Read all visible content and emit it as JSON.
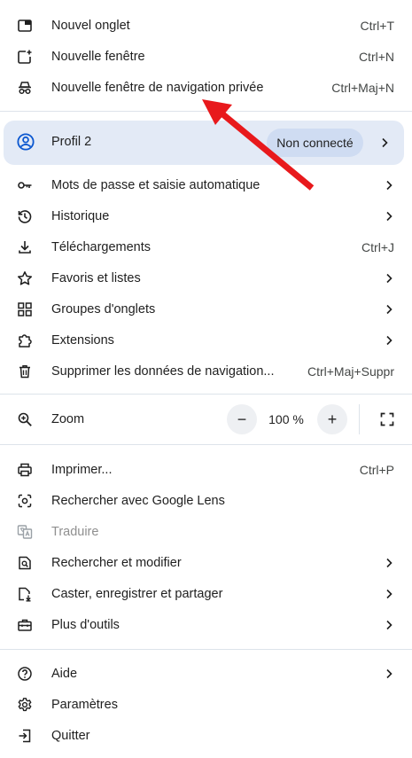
{
  "menu": {
    "new_tab": {
      "label": "Nouvel onglet",
      "shortcut": "Ctrl+T",
      "icon": "new-tab-icon"
    },
    "new_window": {
      "label": "Nouvelle fenêtre",
      "shortcut": "Ctrl+N",
      "icon": "new-window-icon"
    },
    "incognito": {
      "label": "Nouvelle fenêtre de navigation privée",
      "shortcut": "Ctrl+Maj+N",
      "icon": "incognito-icon"
    },
    "profile": {
      "label": "Profil 2",
      "status": "Non connecté",
      "icon": "profile-icon"
    },
    "passwords": {
      "label": "Mots de passe et saisie automatique",
      "icon": "key-icon"
    },
    "history": {
      "label": "Historique",
      "icon": "history-icon"
    },
    "downloads": {
      "label": "Téléchargements",
      "shortcut": "Ctrl+J",
      "icon": "download-icon"
    },
    "bookmarks": {
      "label": "Favoris et listes",
      "icon": "star-icon"
    },
    "tab_groups": {
      "label": "Groupes d'onglets",
      "icon": "tab-groups-icon"
    },
    "extensions": {
      "label": "Extensions",
      "icon": "puzzle-icon"
    },
    "clear_data": {
      "label": "Supprimer les données de navigation...",
      "shortcut": "Ctrl+Maj+Suppr",
      "icon": "trash-icon"
    },
    "zoom": {
      "label": "Zoom",
      "value": "100 %",
      "minus": "−",
      "plus": "+",
      "icon": "zoom-icon"
    },
    "print": {
      "label": "Imprimer...",
      "shortcut": "Ctrl+P",
      "icon": "printer-icon"
    },
    "lens": {
      "label": "Rechercher avec Google Lens",
      "icon": "lens-icon"
    },
    "translate": {
      "label": "Traduire",
      "icon": "translate-icon"
    },
    "find": {
      "label": "Rechercher et modifier",
      "icon": "find-icon"
    },
    "cast": {
      "label": "Caster, enregistrer et partager",
      "icon": "cast-icon"
    },
    "more_tools": {
      "label": "Plus d'outils",
      "icon": "toolbox-icon"
    },
    "help": {
      "label": "Aide",
      "icon": "help-icon"
    },
    "settings": {
      "label": "Paramètres",
      "icon": "gear-icon"
    },
    "quit": {
      "label": "Quitter",
      "icon": "exit-icon"
    }
  },
  "colors": {
    "text": "#1f1f1f",
    "shortcut": "#444746",
    "profile_bg": "#e3eaf6",
    "pill_bg": "#cfdcf2",
    "profile_icon": "#0b57d0",
    "arrow": "#e8191c",
    "separator": "#dde3ea"
  }
}
